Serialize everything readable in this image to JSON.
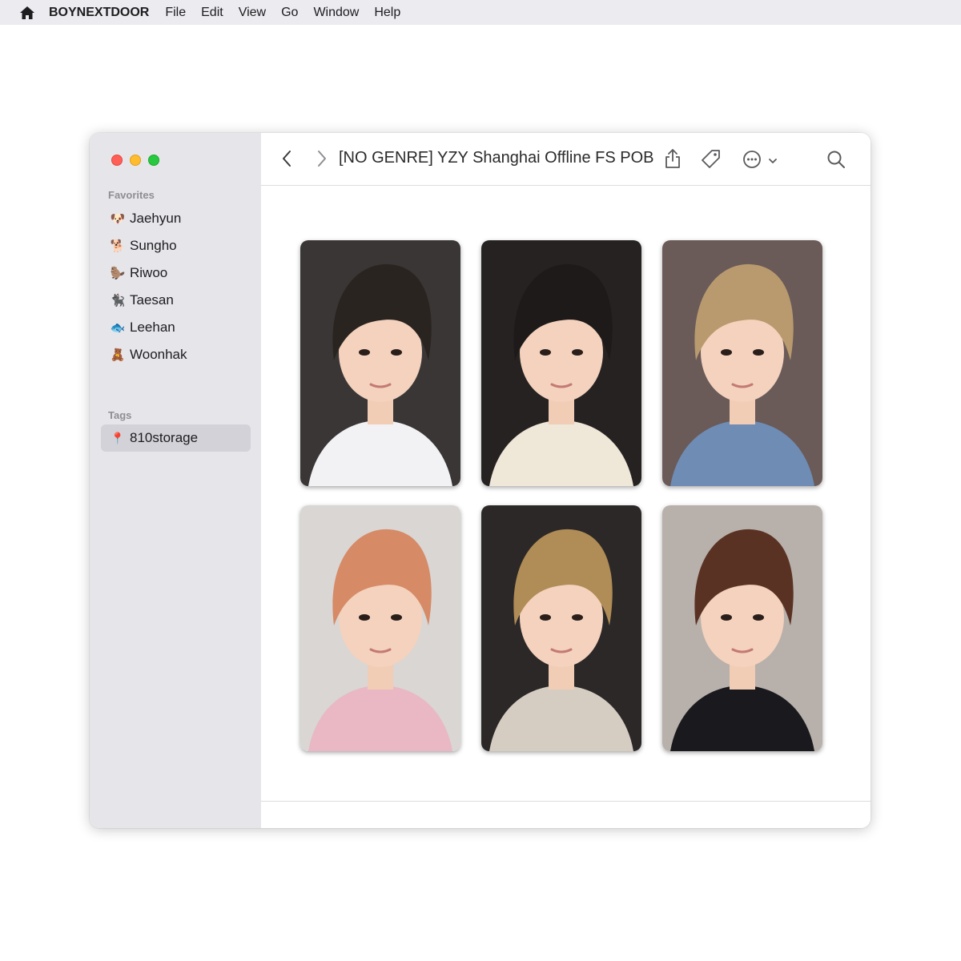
{
  "menubar": {
    "icon": "home-icon",
    "app_name": "BOYNEXTDOOR",
    "items": [
      "File",
      "Edit",
      "View",
      "Go",
      "Window",
      "Help"
    ]
  },
  "sidebar": {
    "favorites_title": "Favorites",
    "favorites": [
      {
        "emoji": "🐶",
        "label": "Jaehyun"
      },
      {
        "emoji": "🐕",
        "label": "Sungho"
      },
      {
        "emoji": "🦫",
        "label": "Riwoo"
      },
      {
        "emoji": "🐈‍⬛",
        "label": "Taesan"
      },
      {
        "emoji": "🐟",
        "label": "Leehan"
      },
      {
        "emoji": "🧸",
        "label": "Woonhak"
      }
    ],
    "tags_title": "Tags",
    "tags": [
      {
        "emoji": "📍",
        "label": "810storage"
      }
    ]
  },
  "toolbar": {
    "title": "[NO GENRE] YZY Shanghai Offline FS POB",
    "icons": [
      "back-chevron-icon",
      "forward-chevron-icon",
      "share-icon",
      "tag-icon",
      "more-icon",
      "chevron-down-icon",
      "search-icon"
    ]
  },
  "photos": [
    {
      "hair": "#2a2420",
      "bg": "#3a3636",
      "shirt": "#f2f2f4"
    },
    {
      "hair": "#1e1a1a",
      "bg": "#262222",
      "shirt": "#efe7d8"
    },
    {
      "hair": "#b89a6e",
      "bg": "#6a5a58",
      "shirt": "#6f8cb4"
    },
    {
      "hair": "#d68a66",
      "bg": "#d9d6d4",
      "shirt": "#e9b8c4"
    },
    {
      "hair": "#b08c56",
      "bg": "#2c2828",
      "shirt": "#d6cdc2"
    },
    {
      "hair": "#5a3224",
      "bg": "#b8b0aa",
      "shirt": "#1a1a1e"
    }
  ],
  "colors": {
    "menubar_bg": "#ebebf0",
    "sidebar_bg": "#e6e5ea",
    "selected_tag_bg": "#d3d2d8"
  }
}
